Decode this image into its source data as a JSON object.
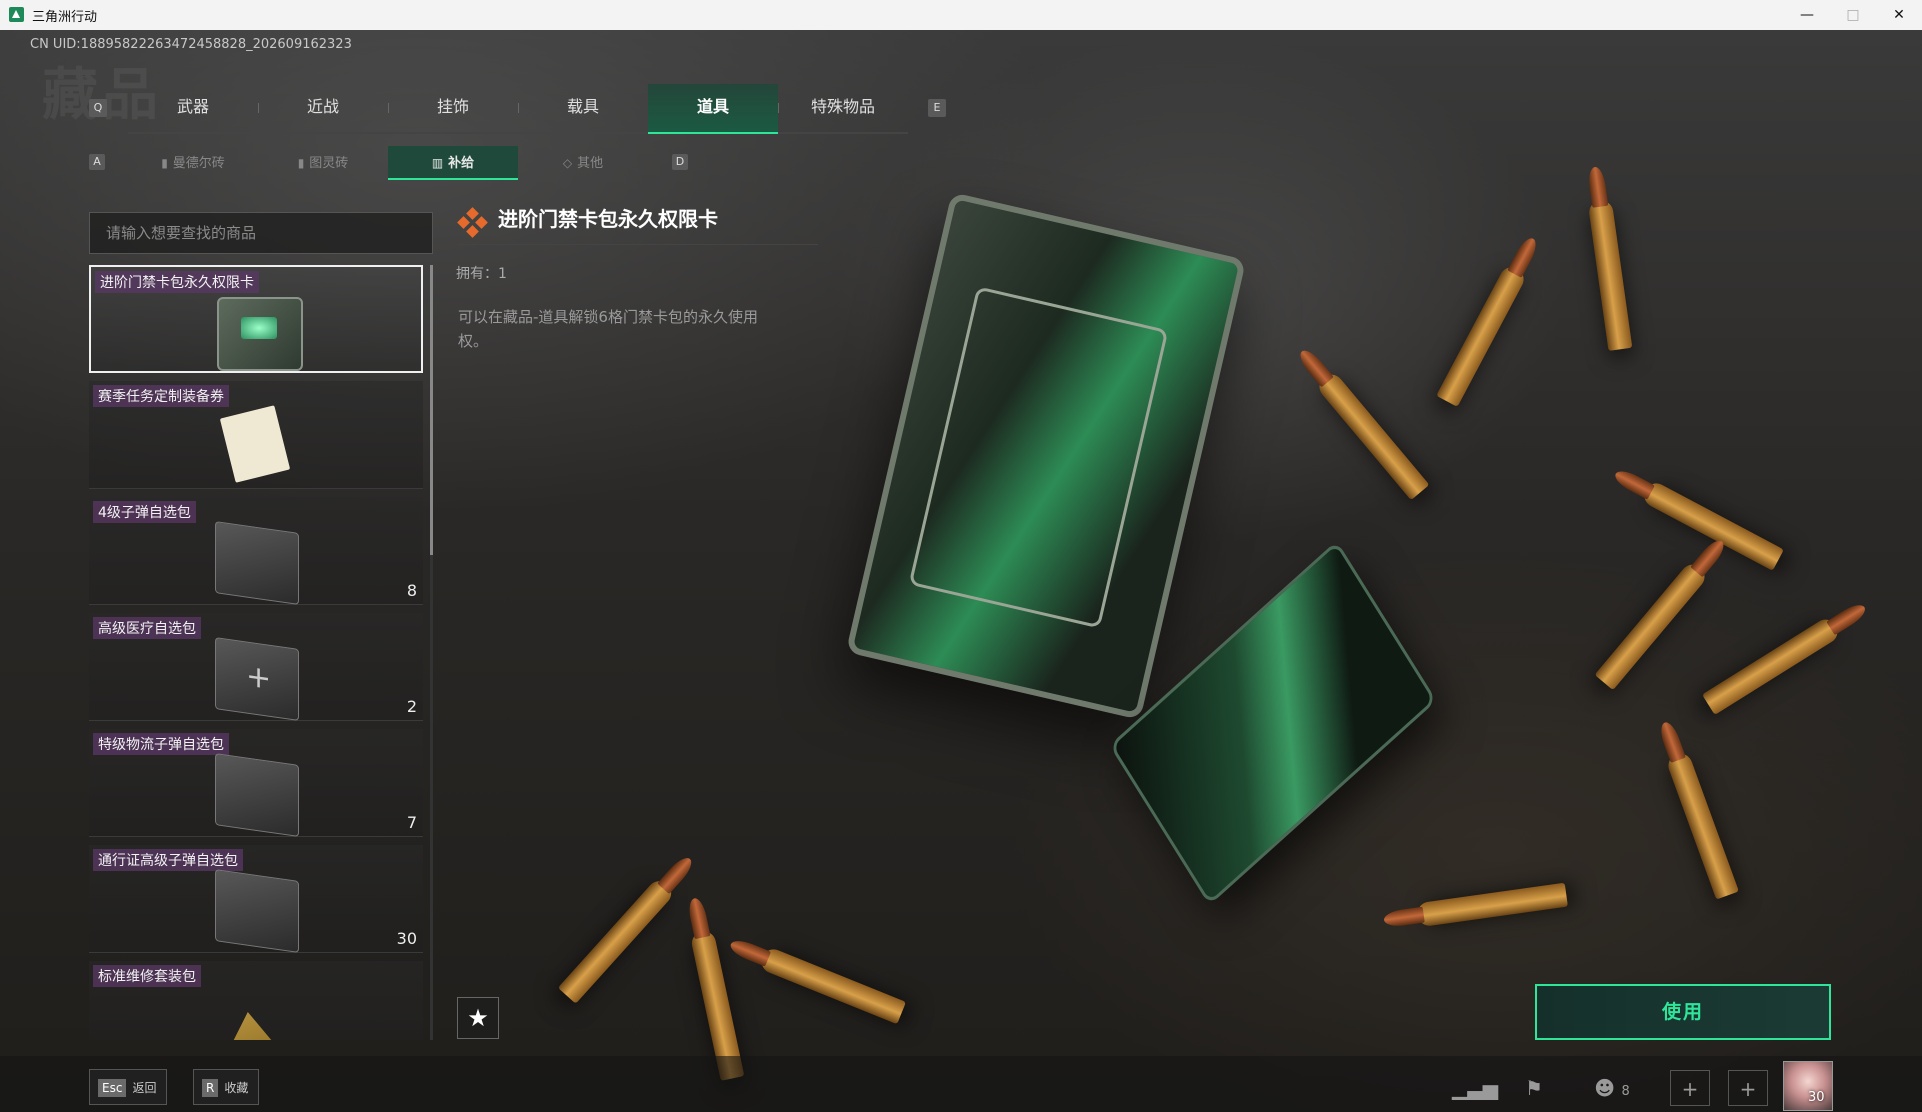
{
  "window": {
    "title": "三角洲行动",
    "minimize_icon": "minimize-icon",
    "maximize_icon": "maximize-icon",
    "close_icon": "close-icon"
  },
  "uid": "CN UID:18895822263472458828_202609162323",
  "ghost_title": "藏品",
  "main_tabs": {
    "key_left": "Q",
    "key_right": "E",
    "items": [
      "武器",
      "近战",
      "挂饰",
      "载具",
      "道具",
      "特殊物品"
    ],
    "active": "道具"
  },
  "sub_tabs": {
    "key_left": "A",
    "key_right": "D",
    "items": [
      "曼德尔砖",
      "图灵砖",
      "补给",
      "其他"
    ],
    "active": "补给"
  },
  "search": {
    "placeholder": "请输入想要查找的商品"
  },
  "items": [
    {
      "name": "进阶门禁卡包永久权限卡",
      "count": "",
      "selected": true
    },
    {
      "name": "赛季任务定制装备券",
      "count": ""
    },
    {
      "name": "4级子弹自选包",
      "count": "8"
    },
    {
      "name": "高级医疗自选包",
      "count": "2"
    },
    {
      "name": "特级物流子弹自选包",
      "count": "7"
    },
    {
      "name": "通行证高级子弹自选包",
      "count": "30"
    },
    {
      "name": "标准维修套装包",
      "count": ""
    }
  ],
  "detail": {
    "title": "进阶门禁卡包永久权限卡",
    "owned": "拥有：1",
    "description": "可以在藏品-道具解锁6格门禁卡包的永久使用权。"
  },
  "actions": {
    "use": "使用",
    "favorite_icon": "star-icon"
  },
  "bottom_bar": {
    "back_key": "Esc",
    "back_label": "返回",
    "fav_key": "R",
    "fav_label": "收藏",
    "friends_count": "8",
    "avatar_level": "30"
  },
  "colors": {
    "accent": "#2fe59a",
    "tag_bg": "#5a3764",
    "diamond": "#e66a2c"
  }
}
